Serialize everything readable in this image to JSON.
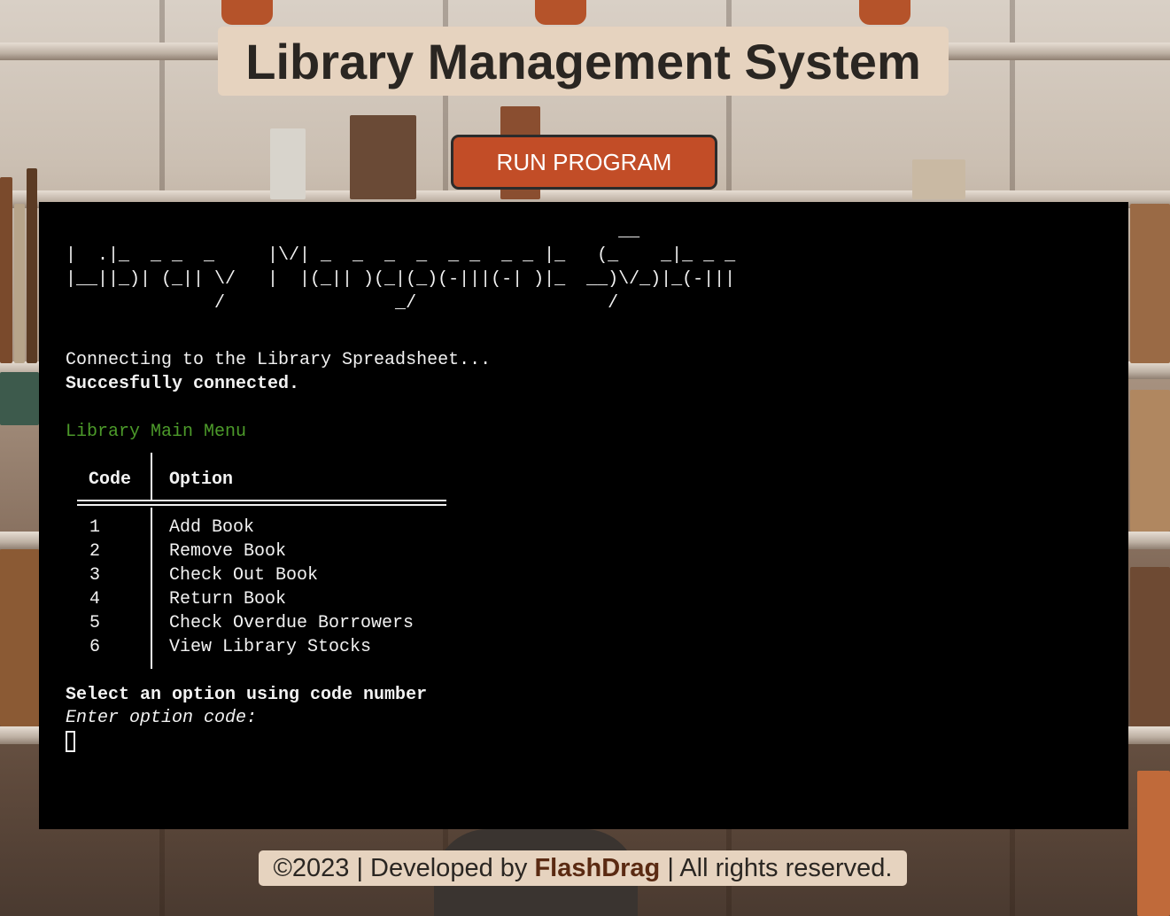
{
  "header": {
    "title": "Library Management System"
  },
  "run_button": {
    "label": "RUN PROGRAM"
  },
  "terminal": {
    "ascii_art": [
      "                                                    __",
      "|  .|_  _ _  _     |\\/| _  _  _  _  _ _  _ _ |_   (_    _|_ _ _",
      "|__||_)| (_|| \\/   |  |(_|| )(_|(_)(-|||(-| )|_  __)\\/_)|_(-|||",
      "              /                _/                  /"
    ],
    "connecting": "Connecting to the Library Spreadsheet...",
    "connected": "Succesfully connected.",
    "menu_title": "Library Main Menu",
    "table": {
      "headers": [
        "Code",
        "Option"
      ],
      "rows": [
        {
          "code": "1",
          "option": "Add Book"
        },
        {
          "code": "2",
          "option": "Remove Book"
        },
        {
          "code": "3",
          "option": "Check Out Book"
        },
        {
          "code": "4",
          "option": "Return Book"
        },
        {
          "code": "5",
          "option": "Check Overdue Borrowers"
        },
        {
          "code": "6",
          "option": "View Library Stocks"
        }
      ]
    },
    "instruction": "Select an option using code number",
    "prompt": "Enter option code:"
  },
  "footer": {
    "prefix": "©2023 | Developed by ",
    "author": "FlashDrag",
    "suffix": " | All rights reserved."
  },
  "colors": {
    "title_bg": "#e6d3bf",
    "button_bg": "#c24d27",
    "terminal_bg": "#000000",
    "menu_title": "#4c9a2a"
  }
}
